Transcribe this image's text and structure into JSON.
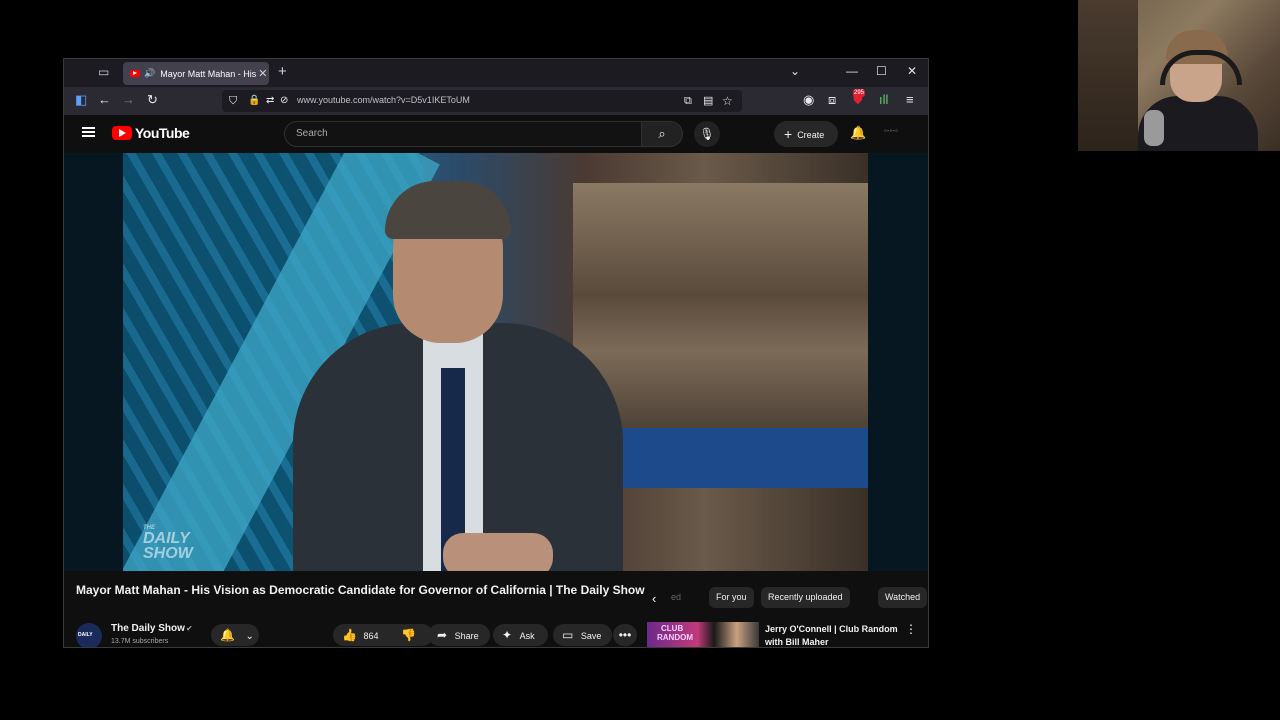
{
  "browser": {
    "tab_title": "Mayor Matt Mahan - His Vision as Democratic Candidate for Governor of California | The Daily Show",
    "url": "www.youtube.com/watch?v=D5v1IKEToUM",
    "extension_badge": "295",
    "new_tab_icon": "plus-icon",
    "window_controls": [
      "minimize-icon",
      "maximize-icon",
      "close-icon"
    ]
  },
  "youtube": {
    "logo_text": "YouTube",
    "search_placeholder": "Search",
    "create_label": "Create"
  },
  "video": {
    "watermark_line1": "THE",
    "watermark_line2": "DAILY",
    "watermark_line3": "SHOW",
    "title": "Mayor Matt Mahan - His Vision as Democratic Candidate for Governor of California | The Daily Show"
  },
  "channel": {
    "name": "The Daily Show",
    "subscribers": "13.7M subscribers",
    "likes": "864",
    "share_label": "Share",
    "ask_label": "Ask",
    "save_label": "Save"
  },
  "chips": [
    "ed",
    "For you",
    "Recently uploaded",
    "Watched"
  ],
  "recommendation": {
    "thumb_text_1": "CLUB",
    "thumb_text_2": "RANDOM",
    "title": "Jerry O'Connell | Club Random with Bill Maher"
  },
  "colors": {
    "accent": "#ff0000",
    "page_bg": "#0f0f0f",
    "chip_bg": "#272727"
  }
}
